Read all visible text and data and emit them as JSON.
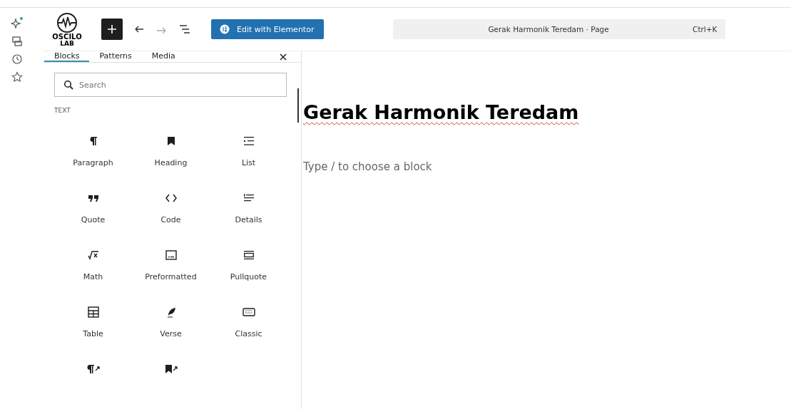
{
  "logo": {
    "line_1": "OSCILO",
    "line_2": "LAB"
  },
  "toolbar": {
    "elementor_button": "Edit with Elementor",
    "command_bar": {
      "title": "Gerak Harmonik Teredam · Page",
      "shortcut": "Ctrl+K"
    }
  },
  "rail": {
    "ai_notification": true
  },
  "inserter": {
    "tabs": [
      {
        "label": "Blocks",
        "selected": true
      },
      {
        "label": "Patterns",
        "selected": false
      },
      {
        "label": "Media",
        "selected": false
      }
    ],
    "search": {
      "placeholder": "Search"
    },
    "section": "TEXT",
    "blocks": [
      {
        "kind": "paragraph",
        "label": "Paragraph"
      },
      {
        "kind": "heading",
        "label": "Heading"
      },
      {
        "kind": "list",
        "label": "List"
      },
      {
        "kind": "quote",
        "label": "Quote"
      },
      {
        "kind": "code",
        "label": "Code"
      },
      {
        "kind": "details",
        "label": "Details"
      },
      {
        "kind": "math",
        "label": "Math"
      },
      {
        "kind": "preformatted",
        "label": "Preformatted"
      },
      {
        "kind": "pullquote",
        "label": "Pullquote"
      },
      {
        "kind": "table",
        "label": "Table"
      },
      {
        "kind": "verse",
        "label": "Verse"
      },
      {
        "kind": "classic",
        "label": "Classic"
      },
      {
        "kind": "paragraph-link"
      },
      {
        "kind": "heading-link"
      }
    ]
  },
  "editor": {
    "title": "Gerak Harmonik Teredam",
    "placeholder": "Type / to choose a block"
  }
}
